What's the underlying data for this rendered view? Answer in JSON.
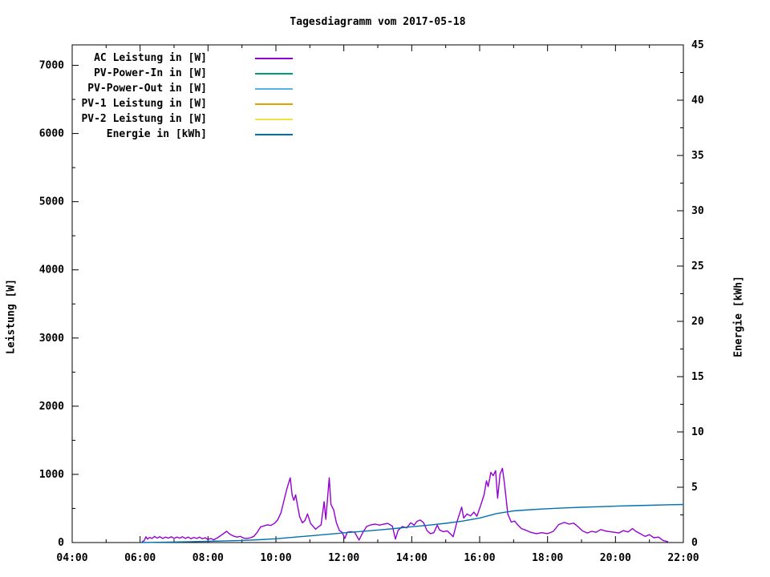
{
  "window": {
    "kind": "gnuplot-chart"
  },
  "chart_data": {
    "type": "line",
    "title": "Tagesdiagramm vom 2017-05-18",
    "xlabel": "",
    "ylabel": "Leistung [W]",
    "y2label": "Energie [kWh]",
    "grid": false,
    "legend_position": "top-left-inside",
    "x_axis": {
      "min": 4,
      "max": 22,
      "major_step_hours": 2,
      "minor_step_hours": 1,
      "tick_labels": [
        "04:00",
        "06:00",
        "08:00",
        "10:00",
        "12:00",
        "14:00",
        "16:00",
        "18:00",
        "20:00",
        "22:00"
      ]
    },
    "y_axis": {
      "min": 0,
      "max": 7300,
      "major_ticks": [
        0,
        1000,
        2000,
        3000,
        4000,
        5000,
        6000,
        7000
      ],
      "minor_step": 500
    },
    "y2_axis": {
      "min": 0,
      "max": 45,
      "major_ticks": [
        0,
        5,
        10,
        15,
        20,
        25,
        30,
        35,
        40,
        45
      ],
      "minor_step": 2.5
    },
    "series": [
      {
        "name": "AC Leistung in [W]",
        "color": "#9400d3",
        "axis": "y1",
        "points": [
          [
            6.05,
            0
          ],
          [
            6.08,
            20
          ],
          [
            6.12,
            25
          ],
          [
            6.17,
            85
          ],
          [
            6.22,
            50
          ],
          [
            6.28,
            75
          ],
          [
            6.35,
            60
          ],
          [
            6.43,
            90
          ],
          [
            6.5,
            65
          ],
          [
            6.58,
            85
          ],
          [
            6.67,
            60
          ],
          [
            6.75,
            80
          ],
          [
            6.83,
            65
          ],
          [
            6.92,
            85
          ],
          [
            7.0,
            60
          ],
          [
            7.08,
            80
          ],
          [
            7.17,
            65
          ],
          [
            7.25,
            85
          ],
          [
            7.33,
            60
          ],
          [
            7.42,
            80
          ],
          [
            7.5,
            55
          ],
          [
            7.58,
            75
          ],
          [
            7.67,
            60
          ],
          [
            7.75,
            80
          ],
          [
            7.83,
            55
          ],
          [
            7.92,
            70
          ],
          [
            8.0,
            45
          ],
          [
            8.08,
            60
          ],
          [
            8.17,
            40
          ],
          [
            8.28,
            70
          ],
          [
            8.4,
            110
          ],
          [
            8.55,
            165
          ],
          [
            8.65,
            120
          ],
          [
            8.75,
            95
          ],
          [
            8.85,
            80
          ],
          [
            8.95,
            90
          ],
          [
            9.05,
            65
          ],
          [
            9.15,
            60
          ],
          [
            9.25,
            70
          ],
          [
            9.35,
            90
          ],
          [
            9.45,
            150
          ],
          [
            9.55,
            230
          ],
          [
            9.65,
            245
          ],
          [
            9.75,
            260
          ],
          [
            9.85,
            250
          ],
          [
            9.95,
            280
          ],
          [
            10.05,
            330
          ],
          [
            10.15,
            440
          ],
          [
            10.23,
            600
          ],
          [
            10.32,
            780
          ],
          [
            10.42,
            950
          ],
          [
            10.48,
            690
          ],
          [
            10.53,
            620
          ],
          [
            10.58,
            700
          ],
          [
            10.63,
            560
          ],
          [
            10.7,
            380
          ],
          [
            10.78,
            290
          ],
          [
            10.85,
            320
          ],
          [
            10.93,
            420
          ],
          [
            11.02,
            280
          ],
          [
            11.1,
            235
          ],
          [
            11.17,
            195
          ],
          [
            11.25,
            230
          ],
          [
            11.33,
            260
          ],
          [
            11.42,
            600
          ],
          [
            11.47,
            340
          ],
          [
            11.57,
            950
          ],
          [
            11.62,
            560
          ],
          [
            11.7,
            480
          ],
          [
            11.78,
            290
          ],
          [
            11.87,
            175
          ],
          [
            11.95,
            150
          ],
          [
            12.03,
            60
          ],
          [
            12.1,
            150
          ],
          [
            12.2,
            160
          ],
          [
            12.32,
            150
          ],
          [
            12.45,
            35
          ],
          [
            12.55,
            140
          ],
          [
            12.67,
            235
          ],
          [
            12.8,
            260
          ],
          [
            12.93,
            270
          ],
          [
            13.05,
            255
          ],
          [
            13.17,
            270
          ],
          [
            13.3,
            280
          ],
          [
            13.43,
            240
          ],
          [
            13.52,
            50
          ],
          [
            13.6,
            180
          ],
          [
            13.72,
            235
          ],
          [
            13.85,
            215
          ],
          [
            13.97,
            290
          ],
          [
            14.07,
            255
          ],
          [
            14.15,
            310
          ],
          [
            14.25,
            330
          ],
          [
            14.35,
            290
          ],
          [
            14.45,
            175
          ],
          [
            14.55,
            130
          ],
          [
            14.65,
            145
          ],
          [
            14.75,
            255
          ],
          [
            14.82,
            185
          ],
          [
            14.92,
            160
          ],
          [
            15.05,
            170
          ],
          [
            15.22,
            85
          ],
          [
            15.33,
            300
          ],
          [
            15.47,
            520
          ],
          [
            15.53,
            360
          ],
          [
            15.63,
            420
          ],
          [
            15.73,
            390
          ],
          [
            15.83,
            445
          ],
          [
            15.92,
            385
          ],
          [
            16.03,
            545
          ],
          [
            16.13,
            700
          ],
          [
            16.2,
            905
          ],
          [
            16.25,
            820
          ],
          [
            16.33,
            1030
          ],
          [
            16.4,
            980
          ],
          [
            16.47,
            1055
          ],
          [
            16.53,
            650
          ],
          [
            16.6,
            1000
          ],
          [
            16.67,
            1090
          ],
          [
            16.73,
            870
          ],
          [
            16.83,
            420
          ],
          [
            16.93,
            300
          ],
          [
            17.03,
            315
          ],
          [
            17.13,
            255
          ],
          [
            17.23,
            205
          ],
          [
            17.37,
            180
          ],
          [
            17.5,
            150
          ],
          [
            17.67,
            130
          ],
          [
            17.83,
            145
          ],
          [
            18.0,
            130
          ],
          [
            18.17,
            165
          ],
          [
            18.33,
            265
          ],
          [
            18.5,
            295
          ],
          [
            18.63,
            270
          ],
          [
            18.77,
            285
          ],
          [
            18.9,
            230
          ],
          [
            19.03,
            170
          ],
          [
            19.17,
            140
          ],
          [
            19.3,
            165
          ],
          [
            19.43,
            150
          ],
          [
            19.57,
            190
          ],
          [
            19.7,
            170
          ],
          [
            19.83,
            160
          ],
          [
            19.97,
            150
          ],
          [
            20.1,
            140
          ],
          [
            20.23,
            175
          ],
          [
            20.37,
            155
          ],
          [
            20.5,
            205
          ],
          [
            20.6,
            165
          ],
          [
            20.73,
            130
          ],
          [
            20.87,
            90
          ],
          [
            21.0,
            115
          ],
          [
            21.13,
            70
          ],
          [
            21.27,
            80
          ],
          [
            21.4,
            30
          ],
          [
            21.55,
            10
          ]
        ]
      },
      {
        "name": "PV-Power-In in [W]",
        "color": "#009e73",
        "axis": "y1",
        "points": []
      },
      {
        "name": "PV-Power-Out in [W]",
        "color": "#56b4e9",
        "axis": "y1",
        "points": []
      },
      {
        "name": "PV-1 Leistung in [W]",
        "color": "#e69f00",
        "axis": "y1",
        "points": []
      },
      {
        "name": "PV-2 Leistung in [W]",
        "color": "#f0e442",
        "axis": "y1",
        "points": []
      },
      {
        "name": "Energie in [kWh]",
        "color": "#0072b2",
        "axis": "y2",
        "points": [
          [
            6.0,
            0
          ],
          [
            6.5,
            0.02
          ],
          [
            7.0,
            0.05
          ],
          [
            7.5,
            0.08
          ],
          [
            8.0,
            0.11
          ],
          [
            8.5,
            0.15
          ],
          [
            9.0,
            0.19
          ],
          [
            9.5,
            0.25
          ],
          [
            10.0,
            0.34
          ],
          [
            10.5,
            0.48
          ],
          [
            11.0,
            0.6
          ],
          [
            11.5,
            0.74
          ],
          [
            12.0,
            0.88
          ],
          [
            12.5,
            1.0
          ],
          [
            13.0,
            1.13
          ],
          [
            13.5,
            1.27
          ],
          [
            14.0,
            1.43
          ],
          [
            14.5,
            1.57
          ],
          [
            15.0,
            1.74
          ],
          [
            15.5,
            1.94
          ],
          [
            16.0,
            2.22
          ],
          [
            16.5,
            2.62
          ],
          [
            17.0,
            2.86
          ],
          [
            17.5,
            2.97
          ],
          [
            18.0,
            3.06
          ],
          [
            18.5,
            3.13
          ],
          [
            19.0,
            3.19
          ],
          [
            19.5,
            3.24
          ],
          [
            20.0,
            3.29
          ],
          [
            20.5,
            3.33
          ],
          [
            21.0,
            3.37
          ],
          [
            21.5,
            3.41
          ],
          [
            22.0,
            3.44
          ]
        ]
      }
    ]
  }
}
